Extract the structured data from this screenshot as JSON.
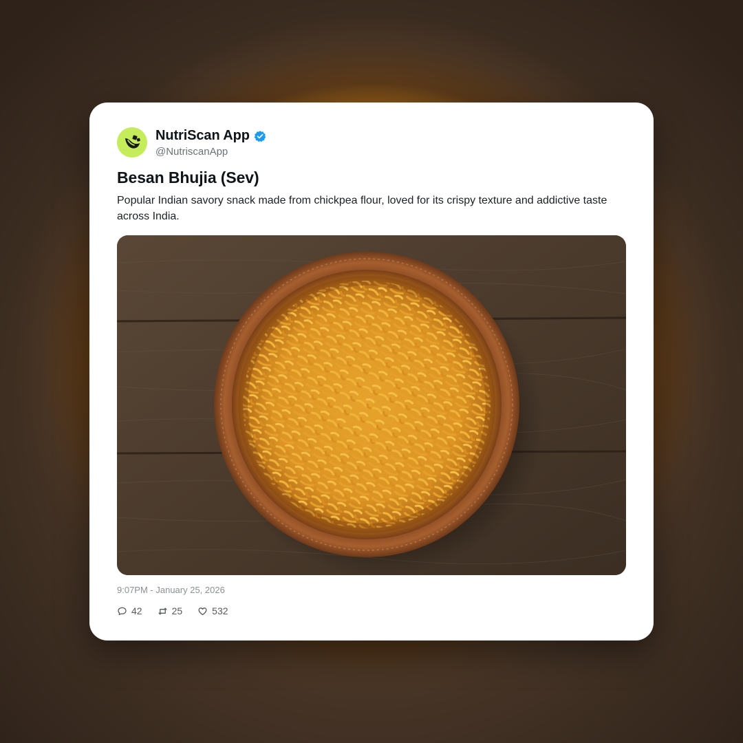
{
  "account": {
    "display_name": "NutriScan App",
    "handle": "@NutriscanApp",
    "verified": true,
    "avatar_icon": "leaf-logo-icon",
    "avatar_color": "#c5ec5a",
    "verified_color": "#1d9bf0"
  },
  "post": {
    "title": "Besan Bhujia (Sev)",
    "description": "Popular Indian savory snack made from chickpea flour, loved for its crispy texture and addictive taste across India.",
    "image_subject": "bowl-of-bhujia-image",
    "timestamp": "9:07PM - January 25, 2026"
  },
  "actions": {
    "replies": {
      "icon": "comment-icon",
      "count": "42"
    },
    "reposts": {
      "icon": "repost-icon",
      "count": "25"
    },
    "likes": {
      "icon": "heart-icon",
      "count": "532"
    }
  }
}
